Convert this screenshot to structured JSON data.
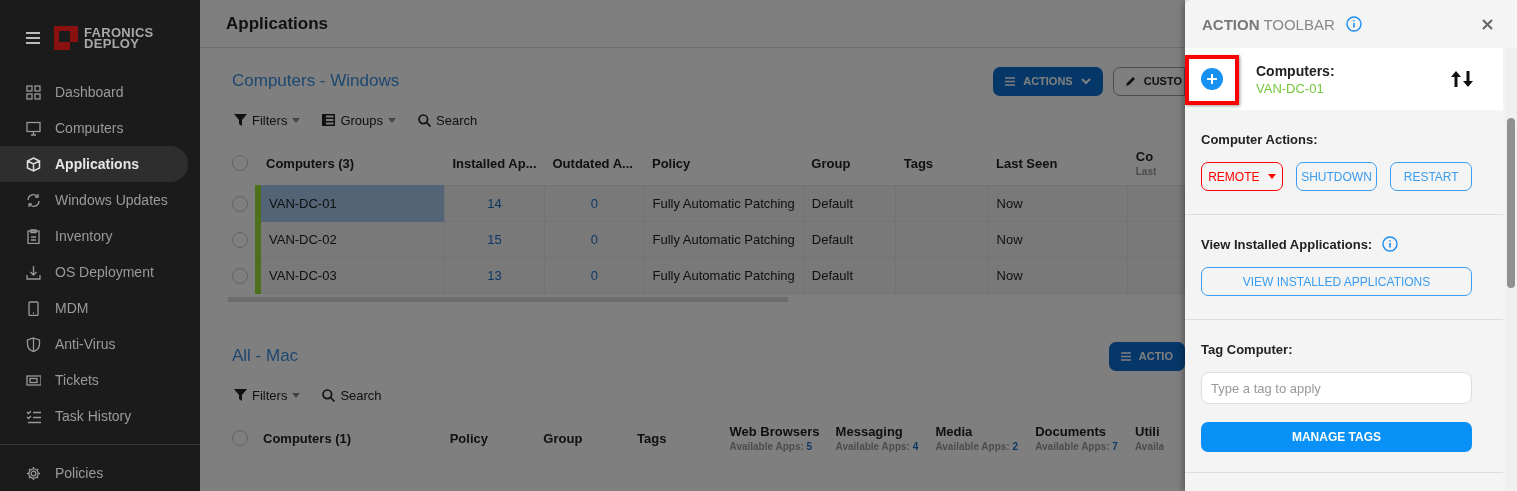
{
  "sidebar": {
    "logo": [
      "FARONICS",
      "DEPLOY"
    ],
    "items": [
      {
        "label": "Dashboard",
        "selected": false
      },
      {
        "label": "Computers",
        "selected": false
      },
      {
        "label": "Applications",
        "selected": true
      },
      {
        "label": "Windows Updates",
        "selected": false
      },
      {
        "label": "Inventory",
        "selected": false
      },
      {
        "label": "OS Deployment",
        "selected": false
      },
      {
        "label": "MDM",
        "selected": false
      },
      {
        "label": "Anti-Virus",
        "selected": false
      },
      {
        "label": "Tickets",
        "selected": false
      },
      {
        "label": "Task History",
        "selected": false
      }
    ],
    "footer_items": [
      {
        "label": "Policies",
        "selected": false
      }
    ]
  },
  "page": {
    "title": "Applications",
    "dimmed": true
  },
  "sections": [
    {
      "title": "Computers - Windows",
      "toolbar": [
        {
          "label": "Filters",
          "kind": "filter"
        },
        {
          "label": "Groups",
          "kind": "groups"
        },
        {
          "label": "Search",
          "kind": "search"
        }
      ],
      "buttons": [
        {
          "label": "ACTIONS",
          "kind": "primary"
        },
        {
          "label": "CUSTO",
          "kind": "outline"
        }
      ],
      "table": {
        "select_all_checked": false,
        "columns": [
          {
            "label": "Computers (3)"
          },
          {
            "label": "Installed Ap..."
          },
          {
            "label": "Outdated A..."
          },
          {
            "label": "Policy"
          },
          {
            "label": "Group"
          },
          {
            "label": "Tags"
          },
          {
            "label": "Last Seen"
          },
          {
            "label": "Co",
            "sub_label": "Last"
          }
        ],
        "rows": [
          {
            "checked": false,
            "selected": true,
            "cells": [
              "VAN-DC-01",
              "14",
              "0",
              "Fully Automatic Patching",
              "Default",
              "",
              "Now",
              ""
            ]
          },
          {
            "checked": false,
            "selected": false,
            "cells": [
              "VAN-DC-02",
              "15",
              "0",
              "Fully Automatic Patching",
              "Default",
              "",
              "Now",
              ""
            ]
          },
          {
            "checked": false,
            "selected": false,
            "cells": [
              "VAN-DC-03",
              "13",
              "0",
              "Fully Automatic Patching",
              "Default",
              "",
              "Now",
              ""
            ]
          }
        ]
      }
    },
    {
      "title": "All - Mac",
      "toolbar": [
        {
          "label": "Filters",
          "kind": "filter"
        },
        {
          "label": "Search",
          "kind": "search"
        }
      ],
      "buttons": [
        {
          "label": "ACTIO",
          "kind": "primary"
        }
      ],
      "table": {
        "select_all_checked": false,
        "columns": [
          {
            "label": "Computers (1)"
          },
          {
            "label": "Policy"
          },
          {
            "label": "Group"
          },
          {
            "label": "Tags"
          },
          {
            "label": "Web Browsers",
            "sub_label": "Available Apps:",
            "sub_count": "5"
          },
          {
            "label": "Messaging",
            "sub_label": "Available Apps:",
            "sub_count": "4"
          },
          {
            "label": "Media",
            "sub_label": "Available Apps:",
            "sub_count": "2"
          },
          {
            "label": "Documents",
            "sub_label": "Available Apps:",
            "sub_count": "7"
          },
          {
            "label": "Utili",
            "sub_label": "Availa"
          }
        ]
      }
    }
  ],
  "panel": {
    "title_bold": "ACTION",
    "title_rest": "TOOLBAR",
    "target": {
      "label": "Computers:",
      "value": "VAN-DC-01",
      "highlighted": true
    },
    "sections": [
      {
        "kind": "buttons",
        "heading": "Computer Actions:",
        "buttons": [
          {
            "label": "REMOTE",
            "kind": "danger",
            "dropdown": true
          },
          {
            "label": "SHUTDOWN",
            "kind": "outline"
          },
          {
            "label": "RESTART",
            "kind": "outline"
          }
        ]
      },
      {
        "kind": "buttons",
        "heading": "View Installed Applications:",
        "info": true,
        "buttons": [
          {
            "label": "VIEW INSTALLED APPLICATIONS",
            "kind": "outline"
          }
        ]
      },
      {
        "kind": "tag",
        "heading": "Tag Computer:",
        "placeholder": "Type a tag to apply",
        "button": "MANAGE TAGS"
      }
    ]
  }
}
